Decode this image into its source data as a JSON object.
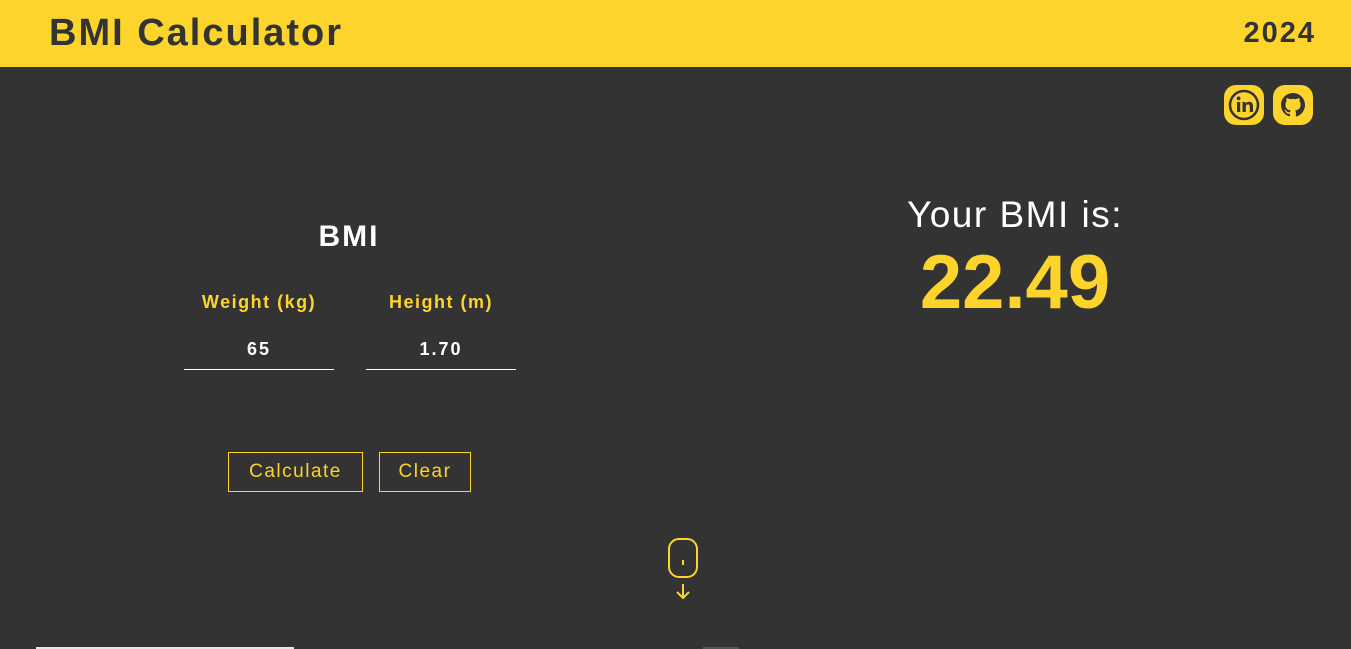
{
  "header": {
    "title": "BMI Calculator",
    "year": "2024",
    "accent_color": "#fdd42c",
    "background_color": "#333333"
  },
  "social": {
    "linkedin_icon": "linkedin-icon",
    "github_icon": "github-icon"
  },
  "form": {
    "title": "BMI",
    "weight_label": "Weight (kg)",
    "weight_value": "65",
    "height_label": "Height (m)",
    "height_value": "1.70",
    "calculate_label": "Calculate",
    "clear_label": "Clear"
  },
  "result": {
    "label": "Your BMI is:",
    "value": "22.49"
  },
  "scroll_icon": "mouse-scroll-down-icon"
}
